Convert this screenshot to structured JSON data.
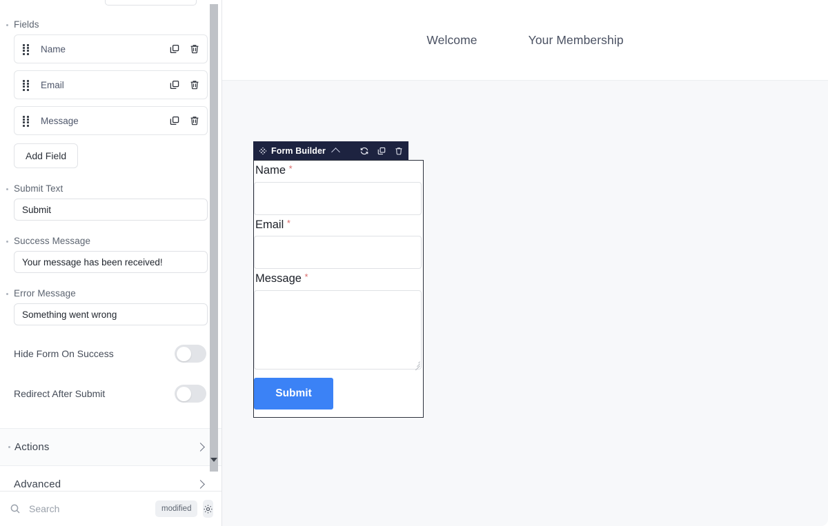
{
  "sidebar": {
    "fields_section": {
      "label": "Fields",
      "items": [
        {
          "name": "Name"
        },
        {
          "name": "Email"
        },
        {
          "name": "Message"
        }
      ],
      "add_button": "Add Field"
    },
    "properties": [
      {
        "label": "Submit Text",
        "value": "Submit"
      },
      {
        "label": "Success Message",
        "value": "Your message has been received!"
      },
      {
        "label": "Error Message",
        "value": "Something went wrong"
      }
    ],
    "toggles": [
      {
        "label": "Hide Form On Success",
        "on": false
      },
      {
        "label": "Redirect After Submit",
        "on": false
      }
    ],
    "accordions": [
      {
        "label": "Actions",
        "has_dot": true
      },
      {
        "label": "Advanced",
        "has_dot": false
      }
    ],
    "footer": {
      "search_placeholder": "Search",
      "search_value": "",
      "badge": "modified",
      "gear_icon": "gear-icon"
    },
    "icons": {
      "drag": "drag-handle-icon",
      "duplicate": "duplicate-icon",
      "delete": "trash-icon",
      "search": "search-icon",
      "chevron": "chevron-right-icon"
    }
  },
  "canvas": {
    "nav_links": [
      "Welcome",
      "Your Membership"
    ],
    "background_color": "#f7f8fa"
  },
  "widget": {
    "title": "Form Builder",
    "header_color": "#1d2340",
    "icons": {
      "move": "move-icon",
      "collapse": "chevron-up-icon",
      "refresh": "refresh-icon",
      "duplicate": "duplicate-icon",
      "delete": "trash-icon"
    },
    "form": {
      "fields": [
        {
          "label": "Name",
          "required_marker": "*",
          "type": "text",
          "value": ""
        },
        {
          "label": "Email",
          "required_marker": "*",
          "type": "text",
          "value": ""
        },
        {
          "label": "Message",
          "required_marker": "*",
          "type": "textarea",
          "value": ""
        }
      ],
      "submit_label": "Submit",
      "submit_color": "#3b82f6"
    }
  }
}
